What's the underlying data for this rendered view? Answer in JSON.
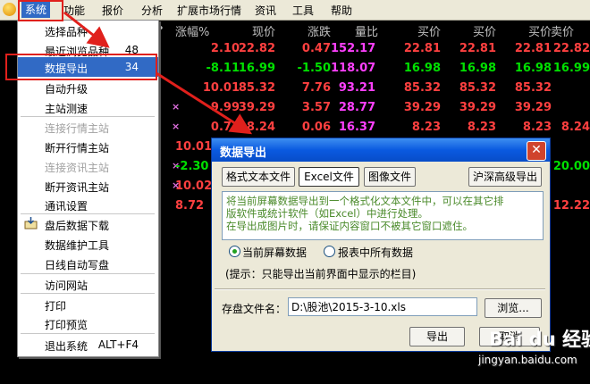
{
  "menubar": {
    "items": [
      "系统",
      "功能",
      "报价",
      "分析",
      "扩展市场行情",
      "资讯",
      "工具",
      "帮助"
    ]
  },
  "grid": {
    "headers": [
      "涨幅%",
      "现价",
      "涨跌",
      "量比",
      "买价",
      "买价",
      "买价",
      "卖价"
    ],
    "rows": [
      [
        "2.10",
        "22.82",
        "0.47",
        "152.17",
        "22.81",
        "22.81",
        "22.81",
        "22.82"
      ],
      [
        "-8.11",
        "16.99",
        "-1.50",
        "118.07",
        "16.98",
        "16.98",
        "16.98",
        "16.99"
      ],
      [
        "10.01",
        "85.32",
        "7.76",
        "93.21",
        "85.32",
        "85.32",
        "85.32",
        ""
      ],
      [
        "9.99",
        "39.29",
        "3.57",
        "28.77",
        "39.29",
        "39.29",
        "39.29",
        ""
      ],
      [
        "0.73",
        "8.24",
        "0.06",
        "16.37",
        "8.23",
        "8.23",
        "8.23",
        "8.24"
      ],
      [
        "10.01",
        "",
        "",
        "",
        "",
        "",
        "",
        ""
      ],
      [
        "-2.30",
        "",
        "",
        "",
        "",
        "",
        "",
        "20.00"
      ],
      [
        "10.02",
        "",
        "",
        "",
        "",
        "",
        "",
        ""
      ],
      [
        "8.72",
        "",
        "",
        "",
        "",
        "",
        "",
        "12.22"
      ],
      [
        "",
        "",
        "",
        "",
        "",
        "",
        "",
        ""
      ]
    ],
    "marks": [
      "×",
      "×",
      "×",
      "×"
    ],
    "colors": {
      "up": "#ff4040",
      "down": "#00e000",
      "ratio": "#ff40ff",
      "bid": "#ffd800"
    }
  },
  "dropdown": {
    "items": [
      {
        "label": "选择品种",
        "shortcut": "",
        "disabled": false
      },
      {
        "label": "最近浏览品种",
        "shortcut": "48",
        "disabled": false
      },
      {
        "label": "数据导出",
        "shortcut": "34",
        "disabled": false,
        "highlighted": true
      },
      {
        "label": "自动升级",
        "shortcut": "",
        "disabled": false
      },
      {
        "label": "主站测速",
        "shortcut": "",
        "disabled": false
      },
      {
        "label": "连接行情主站",
        "shortcut": "",
        "disabled": true
      },
      {
        "label": "断开行情主站",
        "shortcut": "",
        "disabled": false
      },
      {
        "label": "连接资讯主站",
        "shortcut": "",
        "disabled": true
      },
      {
        "label": "断开资讯主站",
        "shortcut": "",
        "disabled": false
      },
      {
        "label": "通讯设置",
        "shortcut": "",
        "disabled": false
      },
      {
        "label": "盘后数据下载",
        "shortcut": "",
        "disabled": false
      },
      {
        "label": "数据维护工具",
        "shortcut": "",
        "disabled": false
      },
      {
        "label": "日线自动写盘",
        "shortcut": "",
        "disabled": false
      },
      {
        "label": "访问网站",
        "shortcut": "",
        "disabled": false
      },
      {
        "label": "打印",
        "shortcut": "",
        "disabled": false
      },
      {
        "label": "打印预览",
        "shortcut": "",
        "disabled": false
      },
      {
        "label": "退出系统",
        "shortcut": "ALT+F4",
        "disabled": false
      }
    ]
  },
  "dialog": {
    "title": "数据导出",
    "close": "✕",
    "tabs": [
      "格式文本文件",
      "Excel文件",
      "图像文件"
    ],
    "extra_button": "沪深高级导出",
    "info_lines": [
      "将当前屏幕数据导出到一个格式化文本文件中，可以在其它排",
      "版软件或统计软件（如Excel）中进行处理。",
      "在导出成图片时，请保证内容窗口不被其它窗口遮住。"
    ],
    "radio_current": "当前屏幕数据",
    "radio_all": "报表中所有数据",
    "hint": "(提示：只能导出当前界面中显示的栏目)",
    "file_label": "存盘文件名：",
    "file_value": "D:\\股池\\2015-3-10.xls",
    "browse": "浏览...",
    "export": "导出",
    "cancel": "取消"
  },
  "watermark": {
    "text": "Bai du 经验",
    "sub": "jingyan.baidu.com"
  }
}
